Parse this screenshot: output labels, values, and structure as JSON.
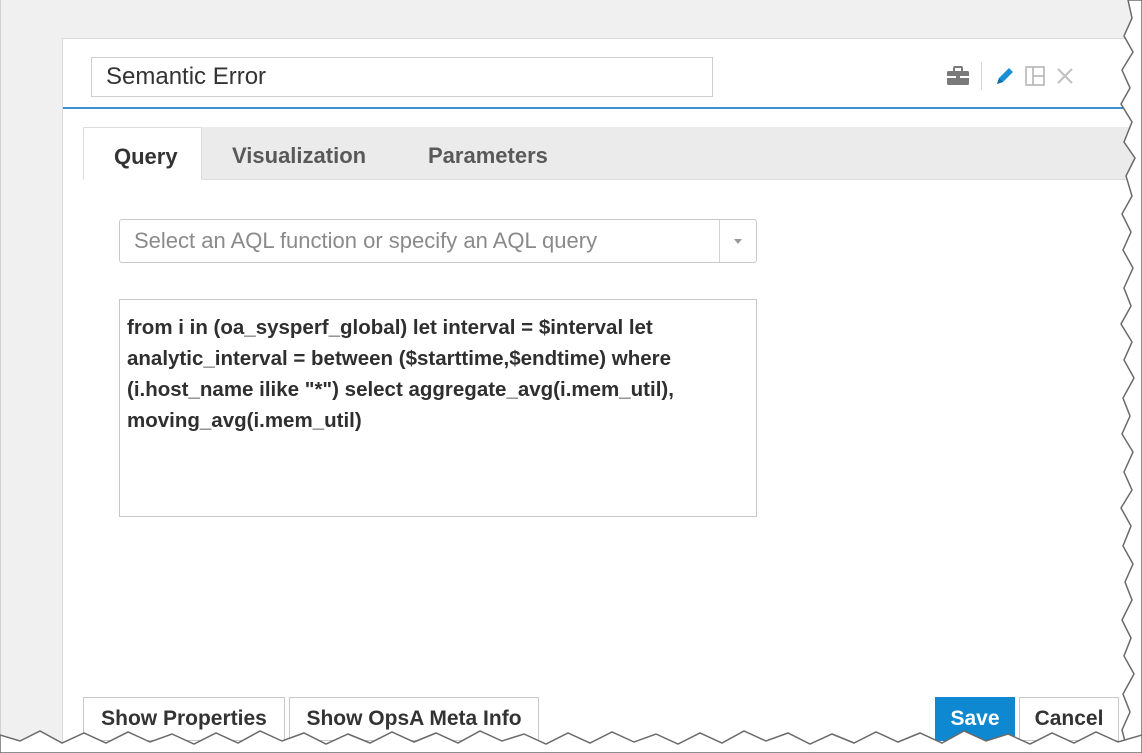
{
  "header": {
    "title_value": "Semantic Error",
    "icons": [
      "briefcase-icon",
      "pencil-icon",
      "layout-icon",
      "close-icon"
    ]
  },
  "tabs": [
    {
      "label": "Query",
      "active": true
    },
    {
      "label": "Visualization",
      "active": false
    },
    {
      "label": "Parameters",
      "active": false
    }
  ],
  "query": {
    "function_select_placeholder": "Select an AQL function or specify an AQL query",
    "text": "from i in (oa_sysperf_global) let interval = $interval let analytic_interval = between ($starttime,$endtime) where (i.host_name ilike \"*\") select aggregate_avg(i.mem_util), moving_avg(i.mem_util)"
  },
  "footer": {
    "show_properties_label": "Show Properties",
    "show_meta_label": "Show OpsA Meta Info",
    "save_label": "Save",
    "cancel_label": "Cancel"
  },
  "colors": {
    "accent": "#0f88d2",
    "header_rule": "#3a8fd0",
    "tab_bar": "#ebebeb"
  }
}
